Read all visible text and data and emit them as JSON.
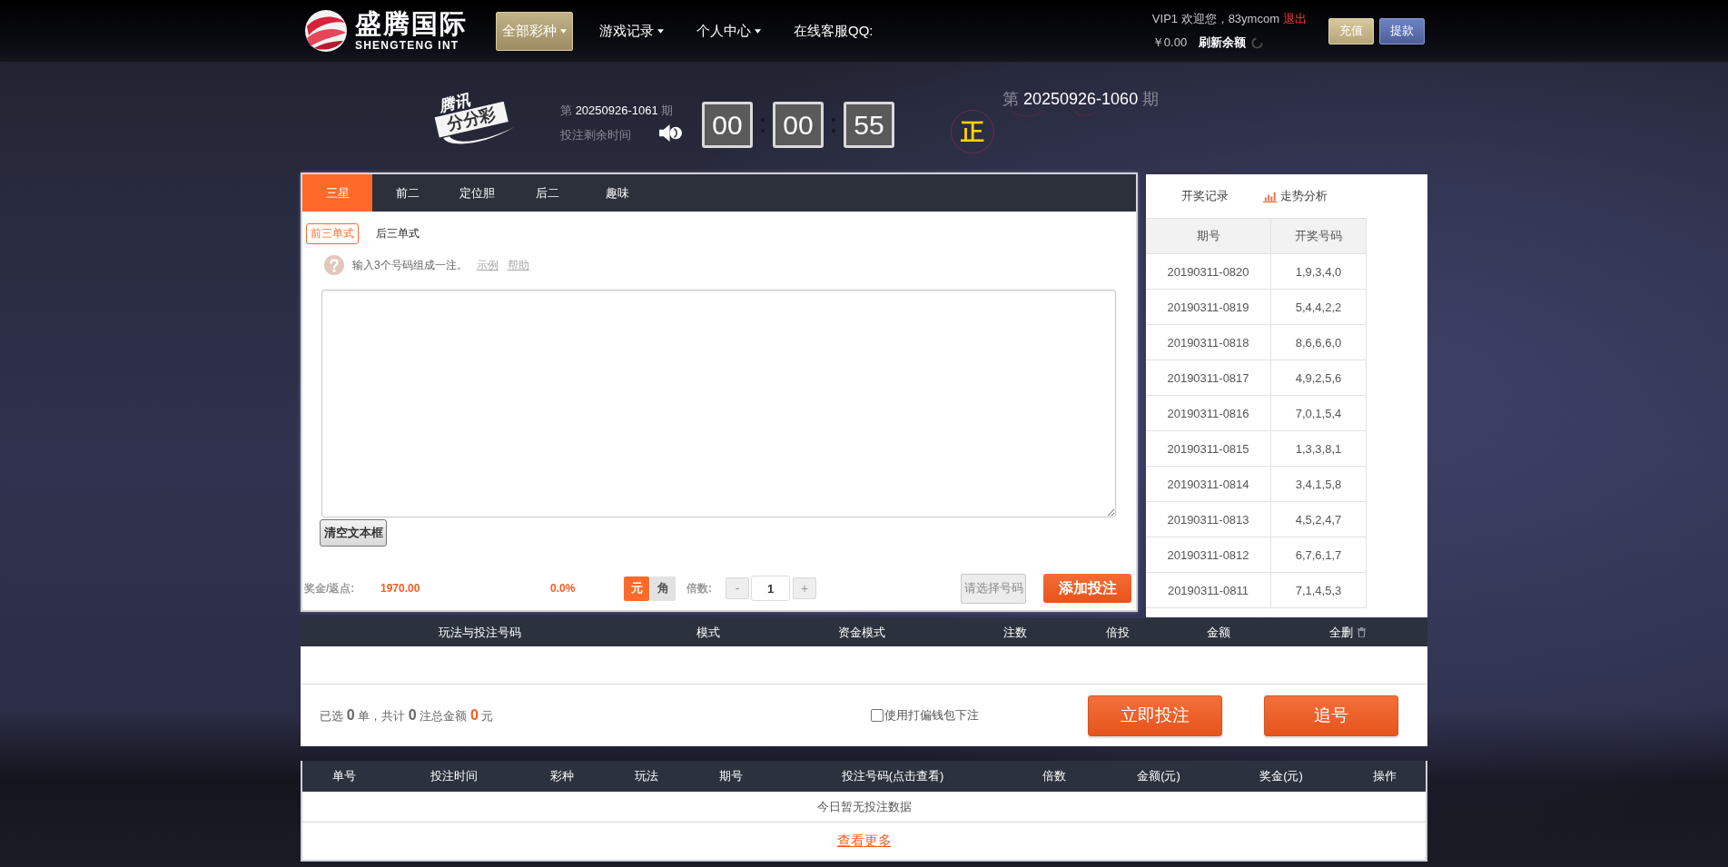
{
  "header": {
    "logo": {
      "name": "盛腾国际",
      "subtitle": "SHENGTENG INT"
    },
    "nav": [
      {
        "label": "全部彩种",
        "selected": true,
        "dropdown": true
      },
      {
        "label": "游戏记录",
        "selected": false,
        "dropdown": true
      },
      {
        "label": "个人中心",
        "selected": false,
        "dropdown": true
      },
      {
        "label": "在线客服QQ:",
        "selected": false,
        "dropdown": false
      }
    ],
    "user": {
      "greeting": "VIP1 欢迎您，83ymcom",
      "logout": "退出",
      "balance": "￥0.00",
      "refresh": "刷新余额"
    },
    "buttons": [
      {
        "label": "充值",
        "kind": "deposit"
      },
      {
        "label": "提款",
        "kind": "withdraw"
      }
    ]
  },
  "lottery": {
    "logo": {
      "title": "腾讯",
      "banner": "分分彩"
    },
    "current_issue": {
      "prefix": "第",
      "number": "20250926-1061",
      "suffix": "期"
    },
    "countdown_label": "投注剩余时间",
    "countdown": [
      "00",
      "00",
      "55"
    ],
    "status": "正",
    "last_issue": {
      "prefix": "第",
      "number": "20250926-1060",
      "suffix": "期"
    }
  },
  "bet_panel": {
    "tabs": [
      {
        "label": "三星",
        "selected": true
      },
      {
        "label": "前二",
        "selected": false
      },
      {
        "label": "定位胆",
        "selected": false
      },
      {
        "label": "后二",
        "selected": false
      },
      {
        "label": "趣味",
        "selected": false
      }
    ],
    "subtabs": [
      {
        "label": "前三单式",
        "selected": true
      },
      {
        "label": "后三单式",
        "selected": false
      }
    ],
    "hint": "输入3个号码组成一注。",
    "hint_links": [
      "示例",
      "帮助"
    ],
    "clear_button": "清空文本框",
    "prize_label": "奖金/返点:",
    "prize": "1970.00",
    "rebate": "0.0%",
    "units": [
      {
        "label": "元",
        "selected": true
      },
      {
        "label": "角",
        "selected": false
      }
    ],
    "multiplier_label": "倍数:",
    "minus": "-",
    "multiplier": "1",
    "plus": "+",
    "select_button": {
      "label": "请选择号码",
      "disabled": true
    },
    "add_button": "添加投注"
  },
  "results": {
    "tabs": [
      {
        "label": "开奖记录",
        "kind": "plain"
      },
      {
        "label": "走势分析",
        "kind": "chart"
      }
    ],
    "columns": [
      "期号",
      "开奖号码"
    ],
    "rows": [
      [
        "20190311-0820",
        "1,9,3,4,0"
      ],
      [
        "20190311-0819",
        "5,4,4,2,2"
      ],
      [
        "20190311-0818",
        "8,6,6,6,0"
      ],
      [
        "20190311-0817",
        "4,9,2,5,6"
      ],
      [
        "20190311-0816",
        "7,0,1,5,4"
      ],
      [
        "20190311-0815",
        "1,3,3,8,1"
      ],
      [
        "20190311-0814",
        "3,4,1,5,8"
      ],
      [
        "20190311-0813",
        "4,5,2,4,7"
      ],
      [
        "20190311-0812",
        "6,7,6,1,7"
      ],
      [
        "20190311-0811",
        "7,1,4,5,3"
      ]
    ]
  },
  "cart": {
    "columns": [
      "玩法与投注号码",
      "模式",
      "资金模式",
      "注数",
      "倍投",
      "金额"
    ],
    "delete_all": "全删",
    "summary": "已选 **0** 单，共计 **0** 注总金额 **0** 元",
    "wallet_option": {
      "label": "使用打偏钱包下注",
      "checked": false
    },
    "buttons": [
      "立即投注",
      "追号"
    ]
  },
  "history": {
    "columns": [
      "单号",
      "投注时间",
      "彩种",
      "玩法",
      "期号",
      "投注号码(点击查看)",
      "倍数",
      "金额(元)",
      "奖金(元)",
      "操作"
    ],
    "empty_text": "今日暂无投注数据",
    "more_link": "查看更多"
  }
}
